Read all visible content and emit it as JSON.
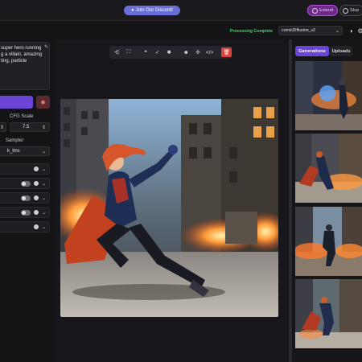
{
  "topbar": {
    "discord_label": "Join Our Discord!",
    "extend_label": "Extend",
    "stop_label": "Stop"
  },
  "subbar": {
    "status": "Processing Complete",
    "model": "comicDiffusion_v2"
  },
  "left": {
    "prompt": "super hero running\ng a villain, amazing\nting, particle",
    "cfg_label": "CFG Scale",
    "cfg_value": "7.5",
    "sampler_label": "Sampler",
    "sampler_value": "k_lms"
  },
  "toolbar": {
    "icons": [
      "share-icon",
      "fullscreen-icon",
      "quote-icon",
      "leaf-icon",
      "asterisk-icon",
      "face-icon",
      "expand-icon",
      "code-icon",
      "trash-icon"
    ]
  },
  "right": {
    "tab_generations": "Generations",
    "tab_uploads": "Uploads"
  },
  "colors": {
    "accent": "#6a45d6",
    "status_green": "#3fd46b",
    "delete_red": "#d9453d",
    "extend_purple": "#b556e0"
  }
}
